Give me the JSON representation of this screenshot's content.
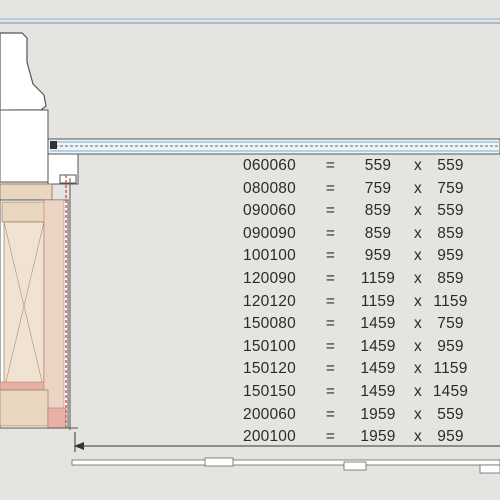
{
  "size_table": {
    "equals_symbol": "=",
    "times_symbol": "x",
    "rows": [
      {
        "code": "060060",
        "width": "559",
        "height": "559"
      },
      {
        "code": "080080",
        "width": "759",
        "height": "759"
      },
      {
        "code": "090060",
        "width": "859",
        "height": "559"
      },
      {
        "code": "090090",
        "width": "859",
        "height": "859"
      },
      {
        "code": "100100",
        "width": "959",
        "height": "959"
      },
      {
        "code": "120090",
        "width": "1159",
        "height": "859"
      },
      {
        "code": "120120",
        "width": "1159",
        "height": "1159"
      },
      {
        "code": "150080",
        "width": "1459",
        "height": "759"
      },
      {
        "code": "150100",
        "width": "1459",
        "height": "959"
      },
      {
        "code": "150120",
        "width": "1459",
        "height": "1159"
      },
      {
        "code": "150150",
        "width": "1459",
        "height": "1459"
      },
      {
        "code": "200060",
        "width": "1959",
        "height": "559"
      },
      {
        "code": "200100",
        "width": "1959",
        "height": "959"
      }
    ]
  },
  "colors": {
    "background": "#e6e4e1",
    "glazing_blue": "#9ec7e0",
    "frame_white": "#ffffff",
    "outline": "#555555",
    "insulation_tan": "#e9d6bf",
    "insulation_red": "#e6b1a4",
    "dimension_line": "#333333"
  }
}
